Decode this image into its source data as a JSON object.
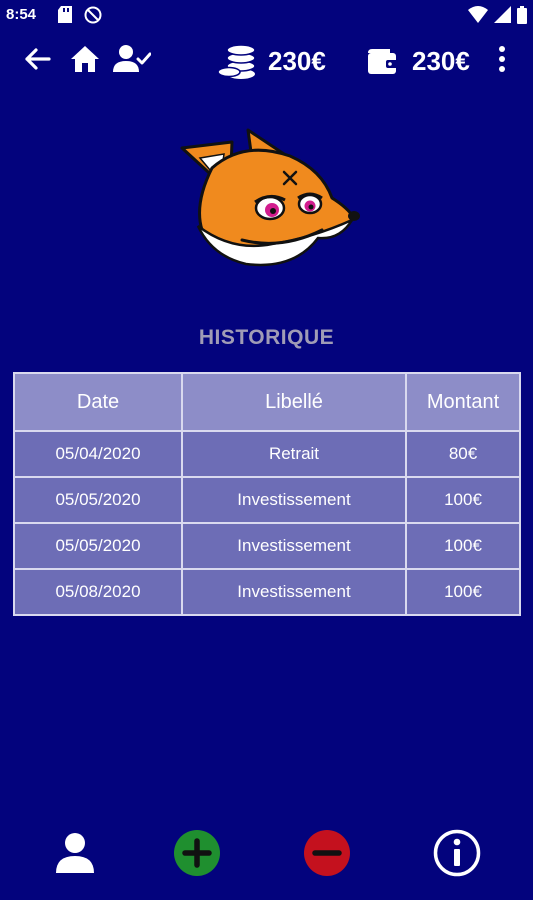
{
  "status": {
    "time": "8:54"
  },
  "header": {
    "coins_amount": "230€",
    "wallet_amount": "230€"
  },
  "icons": {
    "back": "arrow-left-icon",
    "home": "home-icon",
    "user_check": "user-check-icon",
    "coins": "coins-stack-icon",
    "wallet": "wallet-icon",
    "menu": "more-vert-icon",
    "profile": "person-icon",
    "add": "plus-circle-icon",
    "remove": "minus-circle-icon",
    "info": "info-icon"
  },
  "colors": {
    "background": "#03037d",
    "heading": "#a09cb6",
    "add": "#1f8f2f",
    "remove": "#c4111e"
  },
  "history": {
    "title": "HISTORIQUE",
    "columns": [
      "Date",
      "Libellé",
      "Montant"
    ],
    "rows": [
      [
        "05/04/2020",
        "Retrait",
        "80€"
      ],
      [
        "05/05/2020",
        "Investissement",
        "100€"
      ],
      [
        "05/05/2020",
        "Investissement",
        "100€"
      ],
      [
        "05/08/2020",
        "Investissement",
        "100€"
      ]
    ]
  }
}
